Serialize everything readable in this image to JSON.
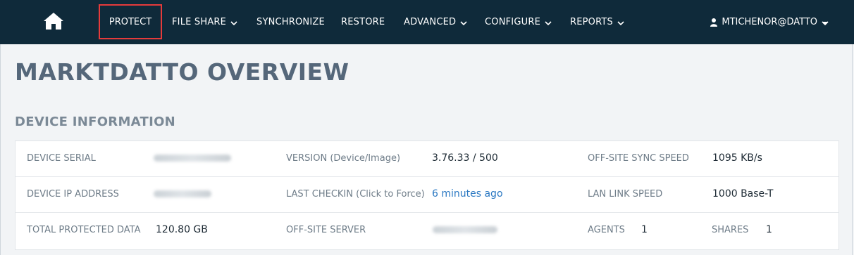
{
  "nav": {
    "items": [
      {
        "label": "PROTECT",
        "has_dropdown": false
      },
      {
        "label": "FILE SHARE",
        "has_dropdown": true
      },
      {
        "label": "SYNCHRONIZE",
        "has_dropdown": false
      },
      {
        "label": "RESTORE",
        "has_dropdown": false
      },
      {
        "label": "ADVANCED",
        "has_dropdown": true
      },
      {
        "label": "CONFIGURE",
        "has_dropdown": true
      },
      {
        "label": "REPORTS",
        "has_dropdown": true
      }
    ],
    "user": "MTICHENOR@DATTO",
    "icons": {
      "home": "home-icon",
      "user": "user-icon",
      "dropdown": "chevron-down-icon"
    },
    "colors": {
      "bar": "#0f2a3a",
      "highlight": "#e53b3b"
    }
  },
  "page": {
    "title": "MARKTDATTO OVERVIEW",
    "section": "DEVICE INFORMATION"
  },
  "device_info": {
    "serial_label": "DEVICE SERIAL",
    "version_label": "VERSION (Device/Image)",
    "version_value": "3.76.33 / 500",
    "sync_speed_label": "OFF-SITE SYNC SPEED",
    "sync_speed_value": "1095 KB/s",
    "ip_label": "DEVICE IP ADDRESS",
    "checkin_label": "LAST CHECKIN (Click to Force)",
    "checkin_value": "6 minutes ago",
    "lan_label": "LAN LINK SPEED",
    "lan_value": "1000 Base-T",
    "protected_label": "TOTAL PROTECTED DATA",
    "protected_value": "120.80 GB",
    "offsite_label": "OFF-SITE SERVER",
    "agents_label": "AGENTS",
    "agents_value": "1",
    "shares_label": "SHARES",
    "shares_value": "1"
  }
}
